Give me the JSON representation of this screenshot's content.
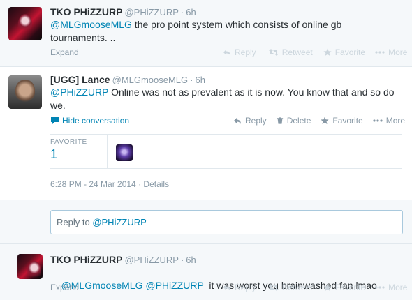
{
  "tweets": [
    {
      "fullname": "TKO PHiZZURP",
      "handle": "@PHiZZURP",
      "time": "6h",
      "mention": "@MLGmooseMLG",
      "text": " the pro point system which consists of online gb tournaments. ..",
      "expand": "Expand",
      "actions": {
        "reply": "Reply",
        "retweet": "Retweet",
        "favorite": "Favorite",
        "more": "More"
      }
    },
    {
      "fullname": "[UGG] Lance",
      "handle": "@MLGmooseMLG",
      "time": "6h",
      "mention": "@PHiZZURP",
      "text": " Online was not as prevalent as it is now. You know that and so do we.",
      "hide_conversation": "Hide conversation",
      "actions": {
        "reply": "Reply",
        "delete": "Delete",
        "favorite": "Favorite",
        "more": "More"
      },
      "stats": {
        "label": "FAVORITE",
        "value": "1"
      },
      "timestamp": "6:28 PM - 24 Mar 2014",
      "details": "Details"
    },
    {
      "fullname": "TKO PHiZZURP",
      "handle": "@PHiZZURP",
      "time": "6h",
      "mention1": "@MLGmooseMLG",
      "mention2": "@PHiZZURP",
      "text": "  it was worst you brainwashed fan lmao",
      "expand": "Expand",
      "actions": {
        "reply": "Reply",
        "retweet": "Retweet",
        "favorite": "Favorite",
        "more": "More"
      }
    }
  ],
  "reply_box": {
    "prefix": "Reply to ",
    "mention": "@PHiZZURP"
  },
  "colors": {
    "link": "#0084b4",
    "muted": "#8899a6",
    "background": "#e9edf0"
  },
  "icons": {
    "reply": "reply-arrow-icon",
    "retweet": "retweet-icon",
    "favorite": "star-icon",
    "more": "ellipsis-icon",
    "delete": "trash-icon",
    "conversation": "speech-bubble-icon"
  }
}
